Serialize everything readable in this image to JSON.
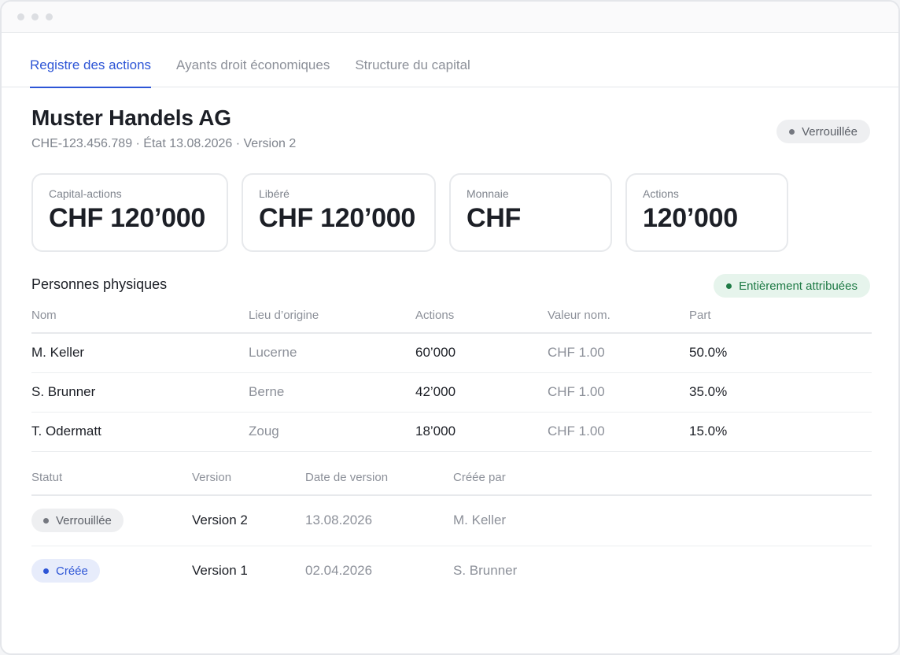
{
  "window": {
    "controls": [
      "close",
      "minimize",
      "zoom"
    ]
  },
  "tabs": [
    {
      "label": "Registre des actions",
      "active": true
    },
    {
      "label": "Ayants droit économiques",
      "active": false
    },
    {
      "label": "Structure du capital",
      "active": false
    }
  ],
  "company": {
    "name": "Muster Handels AG",
    "subtitle": "CHE-123.456.789 · État 13.08.2026 · Version 2",
    "status": "Verrouillée"
  },
  "cards": [
    {
      "label": "Capital-actions",
      "value": "CHF 120’000"
    },
    {
      "label": "Libéré",
      "value": "CHF 120’000"
    },
    {
      "label": "Monnaie",
      "value": "CHF"
    },
    {
      "label": "Actions",
      "value": "120’000"
    }
  ],
  "persons": {
    "title": "Personnes physiques",
    "status": "Entièrement attribuées",
    "columns": [
      "Nom",
      "Lieu d’origine",
      "Actions",
      "Valeur nom.",
      "Part"
    ],
    "rows": [
      {
        "name": "M. Keller",
        "origin": "Lucerne",
        "shares": "60’000",
        "nominal": "CHF 1.00",
        "part": "50.0%"
      },
      {
        "name": "S. Brunner",
        "origin": "Berne",
        "shares": "42’000",
        "nominal": "CHF 1.00",
        "part": "35.0%"
      },
      {
        "name": "T. Odermatt",
        "origin": "Zoug",
        "shares": "18’000",
        "nominal": "CHF 1.00",
        "part": "15.0%"
      }
    ]
  },
  "versions": {
    "columns": [
      "Statut",
      "Version",
      "Date de version",
      "Créée par"
    ],
    "rows": [
      {
        "status": "Verrouillée",
        "status_color": "#757880",
        "version": "Version 2",
        "date": "13.08.2026",
        "author": "M. Keller"
      },
      {
        "status": "Créée",
        "status_color": "#2d55d6",
        "version": "Version 1",
        "date": "02.04.2026",
        "author": "S. Brunner"
      }
    ]
  },
  "colors": {
    "accent": "#2d55d6",
    "success": "#1e7a45",
    "locked": "#757880"
  }
}
